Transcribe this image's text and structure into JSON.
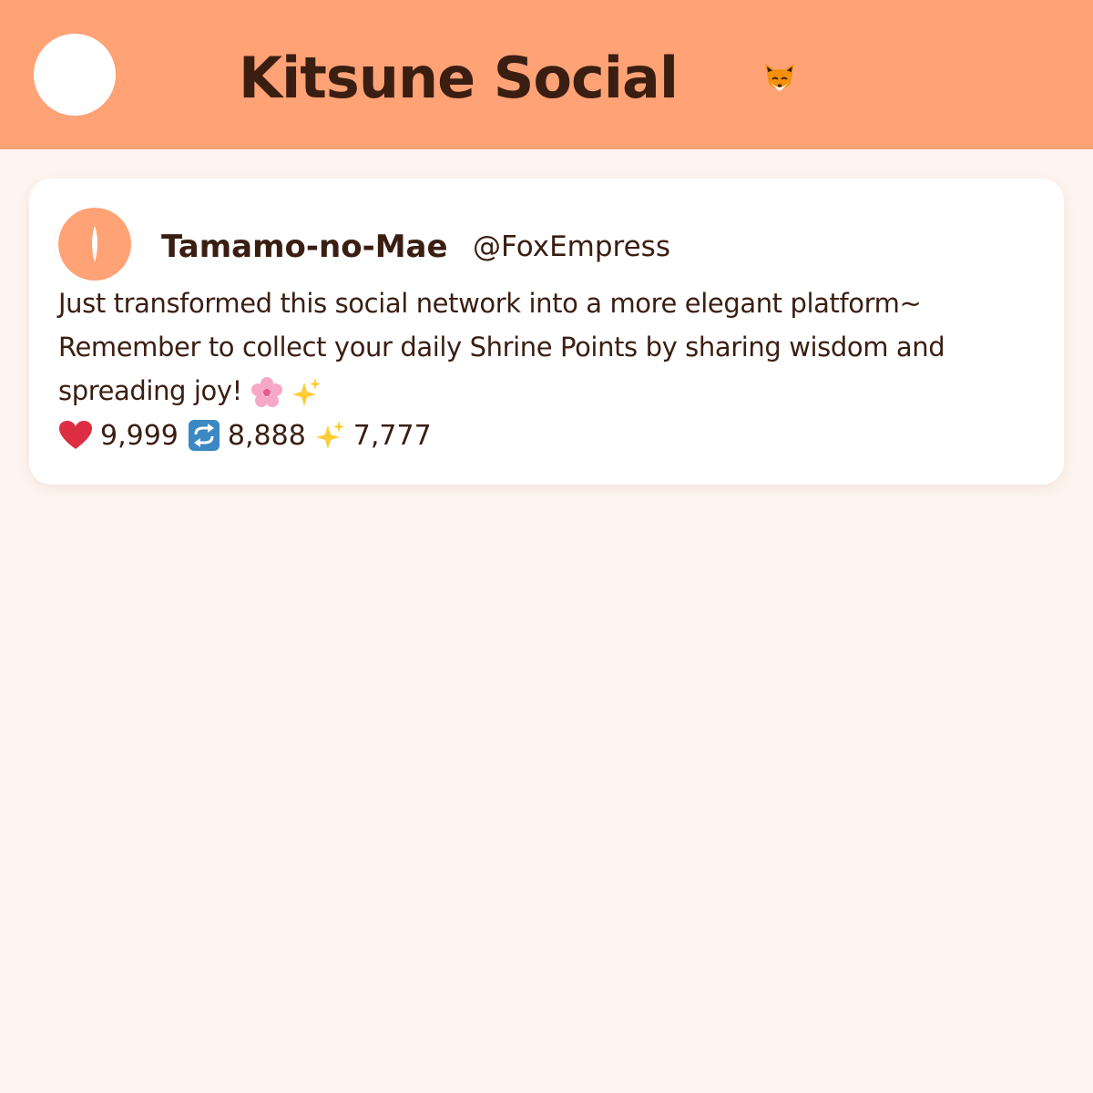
{
  "header": {
    "title": "Kitsune Social",
    "avatar_icon": "profile-avatar",
    "logo_icon": "fox-face-icon"
  },
  "colors": {
    "header_bg": "#ffa276",
    "page_bg": "#fdf4ef",
    "text": "#3a1e12",
    "card_bg": "#ffffff",
    "heart": "#dd2e44",
    "sparkle": "#ffcc33",
    "repost": "#3b88c3"
  },
  "post": {
    "author_name": "Tamamo-no-Mae",
    "author_handle": "@FoxEmpress",
    "text_lines": [
      "Just transformed this social network into a more elegant platform~",
      "Remember to collect your daily Shrine Points by sharing wisdom and",
      "spreading joy!"
    ],
    "text_emojis": [
      "cherry-blossom-icon",
      "sparkles-icon"
    ],
    "stats": {
      "likes": "9,999",
      "reposts": "8,888",
      "sparkles": "7,777"
    }
  }
}
